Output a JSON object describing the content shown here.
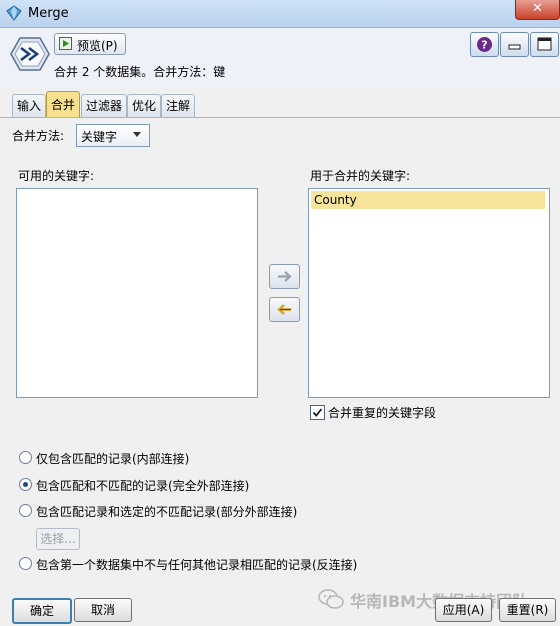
{
  "window": {
    "title": "Merge"
  },
  "header": {
    "preview_label": "预览(P)",
    "subtitle": "合并 2 个数据集。合并方法：键"
  },
  "tabs": [
    {
      "label": "输入"
    },
    {
      "label": "合并",
      "active": true
    },
    {
      "label": "过滤器"
    },
    {
      "label": "优化"
    },
    {
      "label": "注解"
    }
  ],
  "merge": {
    "method_label": "合并方法:",
    "method_value": "关键字",
    "available_label": "可用的关键字:",
    "used_label": "用于合并的关键字:",
    "used_items": [
      "County"
    ],
    "combine_duplicates_label": "合并重复的关键字段",
    "combine_duplicates_checked": true
  },
  "join_options": [
    {
      "label": "仅包含匹配的记录(内部连接)",
      "selected": false
    },
    {
      "label": "包含匹配和不匹配的记录(完全外部连接)",
      "selected": true
    },
    {
      "label": "包含匹配记录和选定的不匹配记录(部分外部连接)",
      "selected": false
    },
    {
      "label": "包含第一个数据集中不与任何其他记录相匹配的记录(反连接)",
      "selected": false
    }
  ],
  "select_button": "选择...",
  "footer": {
    "ok": "确定",
    "cancel": "取消",
    "apply": "应用(A)",
    "reset": "重置(R)"
  },
  "watermark": "华南IBM大数据支持团队",
  "colors": {
    "active_tab": "#f7e08e",
    "selected_item": "#f6e49b",
    "close_button": "#c8412a",
    "help_icon": "#6a2a8a"
  }
}
